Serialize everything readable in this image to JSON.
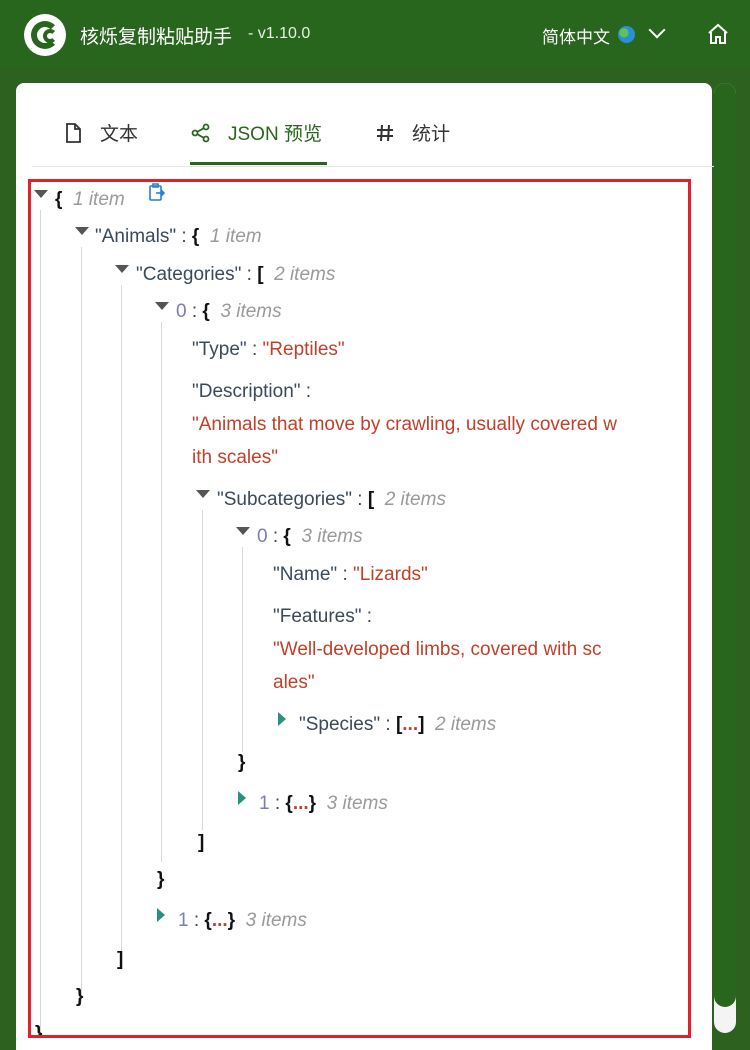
{
  "header": {
    "title": "核烁复制粘贴助手",
    "version": "- v1.10.0",
    "language": "简体中文"
  },
  "tabs": [
    {
      "label": "文本",
      "icon": "document-icon",
      "active": false
    },
    {
      "label": "JSON 预览",
      "icon": "share-nodes-icon",
      "active": true
    },
    {
      "label": "统计",
      "icon": "hash-icon",
      "active": false
    }
  ],
  "tree": {
    "root_count": "1 item",
    "animals_key": "\"Animals\"",
    "animals_count": "1 item",
    "categories_key": "\"Categories\"",
    "categories_count": "2 items",
    "cat0_index": "0",
    "cat0_count": "3 items",
    "type_key": "\"Type\"",
    "type_value": "\"Reptiles\"",
    "desc_key": "\"Description\"",
    "desc_value_1": "\"Animals that move by crawling, usually covered w",
    "desc_value_2": "ith scales\"",
    "subcat_key": "\"Subcategories\"",
    "subcat_count": "2 items",
    "sub0_index": "0",
    "sub0_count": "3 items",
    "name_key": "\"Name\"",
    "name_value": "\"Lizards\"",
    "features_key": "\"Features\"",
    "features_value_1": "\"Well-developed limbs, covered with sc",
    "features_value_2": "ales\"",
    "species_key": "\"Species\"",
    "species_count": "2 items",
    "sub1_index": "1",
    "sub1_count": "3 items",
    "cat1_index": "1",
    "cat1_count": "3 items"
  },
  "colors": {
    "brand": "#28661d",
    "highlight_border": "#e0202a",
    "string": "#c0402a"
  }
}
